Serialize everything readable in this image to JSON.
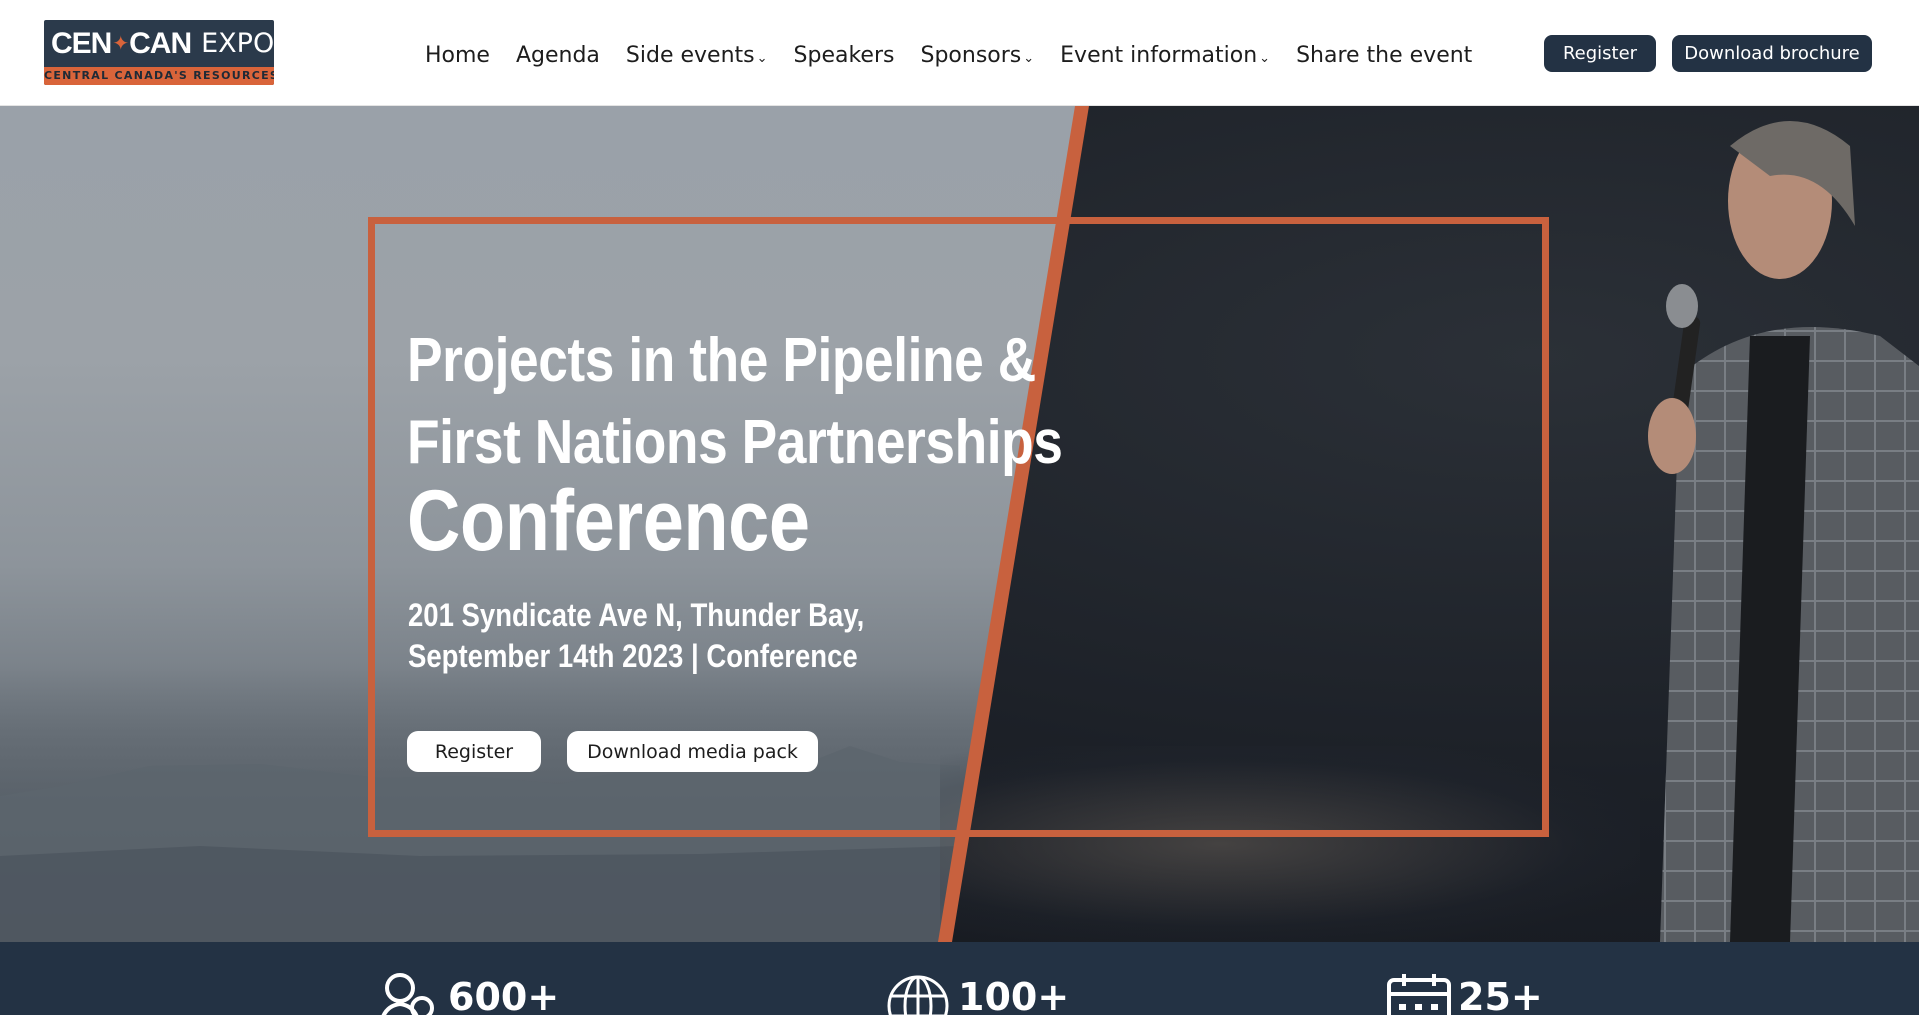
{
  "header": {
    "logo": {
      "word_left": "CEN",
      "word_right": "CAN",
      "word_expo": "EXPO",
      "tagline": "CENTRAL CANADA'S RESOURCES"
    },
    "nav": [
      {
        "label": "Home",
        "dropdown": false
      },
      {
        "label": "Agenda",
        "dropdown": false
      },
      {
        "label": "Side events",
        "dropdown": true
      },
      {
        "label": "Speakers",
        "dropdown": false
      },
      {
        "label": "Sponsors",
        "dropdown": true
      },
      {
        "label": "Event information",
        "dropdown": true
      },
      {
        "label": "Share the event",
        "dropdown": false
      }
    ],
    "register_label": "Register",
    "brochure_label": "Download brochure"
  },
  "hero": {
    "title_line1": "Projects in the Pipeline &",
    "title_line2": "First Nations Partnerships",
    "title_line3": "Conference",
    "address": "201 Syndicate Ave N, Thunder Bay,",
    "date_line": "September 14th 2023 | Conference",
    "register_label": "Register",
    "media_label": "Download media pack"
  },
  "stats": [
    {
      "icon": "people-icon",
      "value": "600+"
    },
    {
      "icon": "globe-icon",
      "value": "100+"
    },
    {
      "icon": "calendar-icon",
      "value": "25+"
    }
  ],
  "colors": {
    "accent": "#c8613e",
    "navy": "#233244",
    "white": "#ffffff"
  },
  "chevron": "⌄",
  "maple": "✦"
}
